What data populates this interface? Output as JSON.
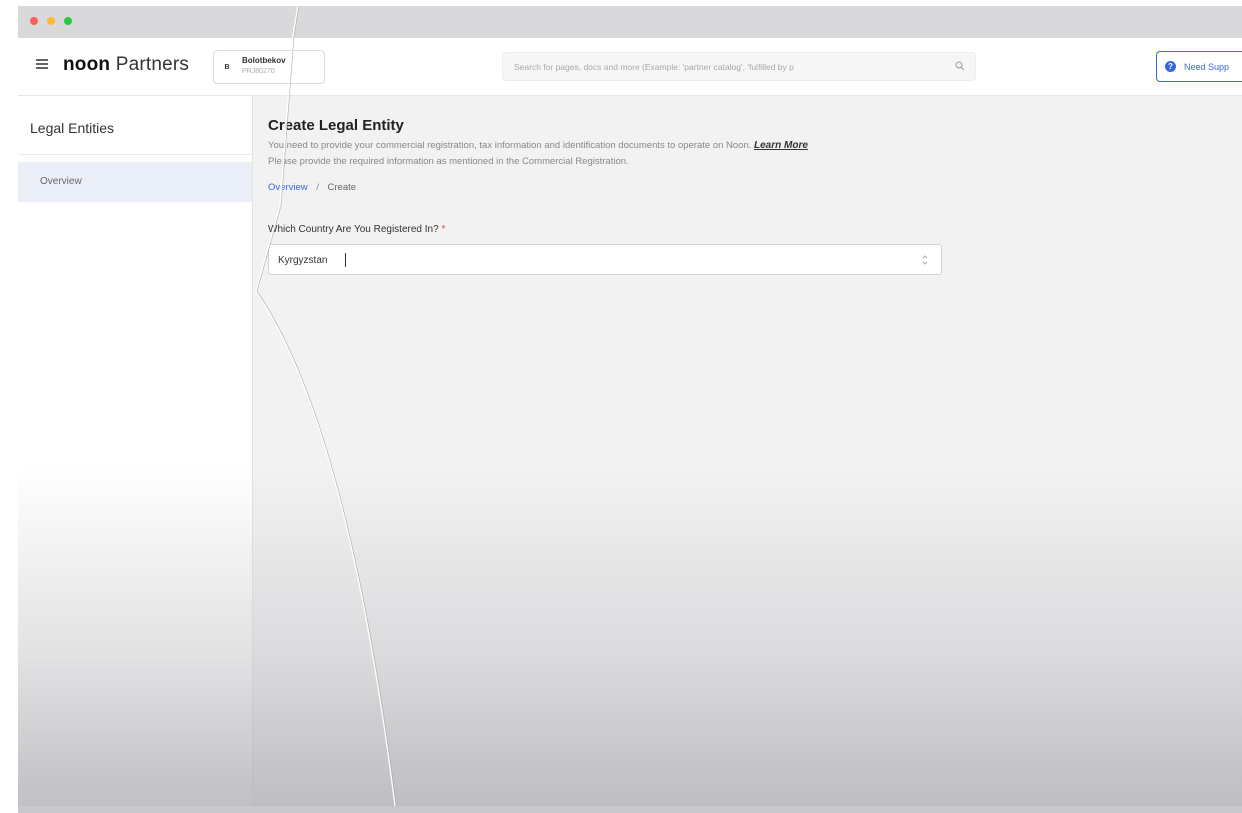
{
  "window": {
    "controls": [
      "close",
      "minimize",
      "maximize"
    ]
  },
  "topbar": {
    "brand_bold": "noon",
    "brand_light": "Partners",
    "account": {
      "badge": "B",
      "name": "Bolotbekov",
      "sub": "PRJ80270"
    },
    "search": {
      "placeholder": "Search for pages, docs and more (Example: 'partner catalog', 'fulfilled by p"
    },
    "support_label": "Need Supp",
    "support_icon": "question-icon",
    "support_color": "#3866df"
  },
  "sidebar": {
    "title": "Legal Entities",
    "items": [
      {
        "label": "Overview",
        "active": true
      }
    ]
  },
  "main": {
    "title": "Create Legal Entity",
    "description_line1": "You need to provide your commercial registration, tax information and identification documents to operate on Noon.",
    "learn_more": "Learn More",
    "description_line2": "Please provide the required information as mentioned in the Commercial Registration.",
    "breadcrumb": {
      "link": "Overview",
      "separator": "/",
      "current": "Create"
    },
    "country_field": {
      "label": "Which Country Are You Registered In?",
      "required_mark": "*",
      "value": "Kyrgyzstan"
    }
  },
  "colors": {
    "accent": "#3866df",
    "required": "#e2463d",
    "sidebar_active_bg": "#e9eef7"
  }
}
